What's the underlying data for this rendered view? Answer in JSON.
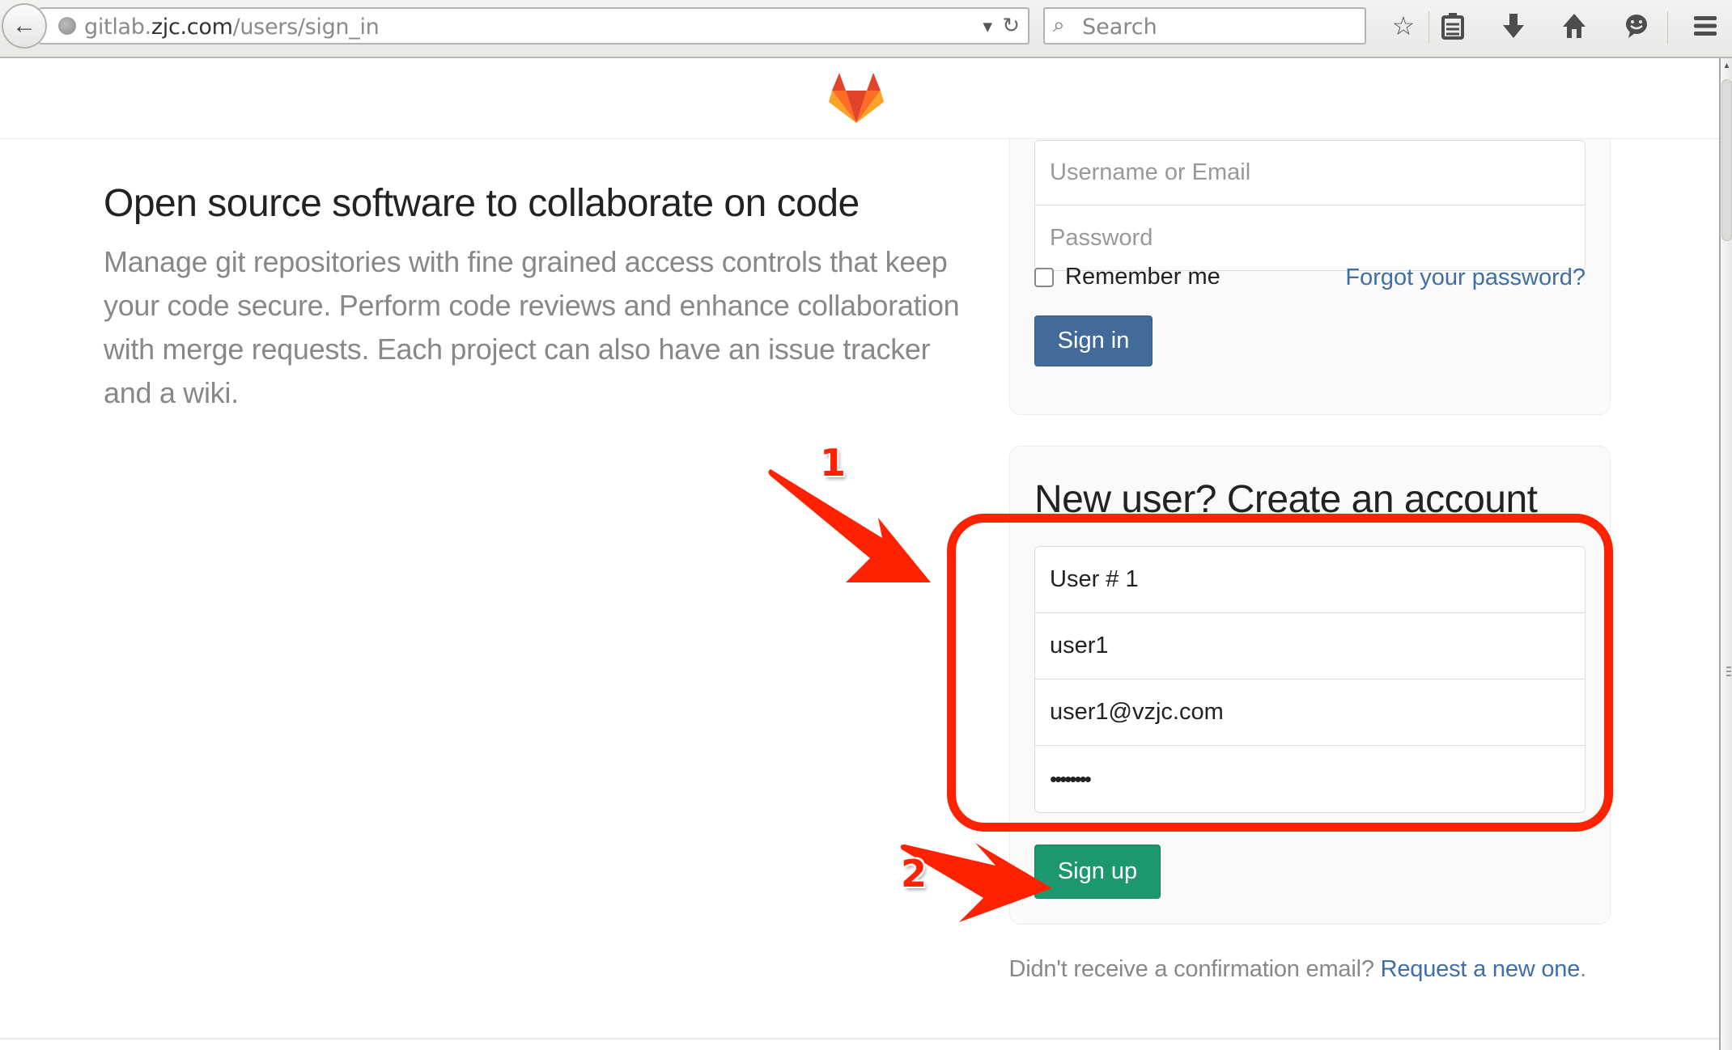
{
  "browser": {
    "url_prefix": "gitlab.",
    "url_domain": "zjc.com",
    "url_path": "/users/sign_in",
    "search_placeholder": "Search",
    "toolbar_icons": [
      "bookmark-star-icon",
      "reading-list-icon",
      "downloads-icon",
      "home-icon",
      "chat-icon",
      "menu-icon"
    ]
  },
  "header": {
    "logo": "gitlab-tanuki-logo"
  },
  "intro": {
    "title": "Open source software to collaborate on code",
    "body": "Manage git repositories with fine grained access controls that keep your code secure. Perform code reviews and enhance collaboration with merge requests. Each project can also have an issue tracker and a wiki."
  },
  "signin": {
    "username_placeholder": "Username or Email",
    "password_placeholder": "Password",
    "remember_label": "Remember me",
    "remember_checked": false,
    "forgot_link": "Forgot your password?",
    "submit_label": "Sign in"
  },
  "signup": {
    "title": "New user? Create an account",
    "fields": [
      {
        "name": "name",
        "value": "User # 1"
      },
      {
        "name": "username",
        "value": "user1"
      },
      {
        "name": "email",
        "value": "user1@vzjc.com"
      },
      {
        "name": "password",
        "value": "••••••••"
      }
    ],
    "submit_label": "Sign up"
  },
  "confirmation": {
    "text": "Didn't receive a confirmation email? ",
    "link": "Request a new one",
    "suffix": "."
  },
  "annotations": {
    "step1": "1",
    "step2": "2",
    "color": "#ff2200"
  },
  "colors": {
    "signin_button": "#426b99",
    "signup_button": "#1c9870",
    "link": "#3f6fa7"
  }
}
